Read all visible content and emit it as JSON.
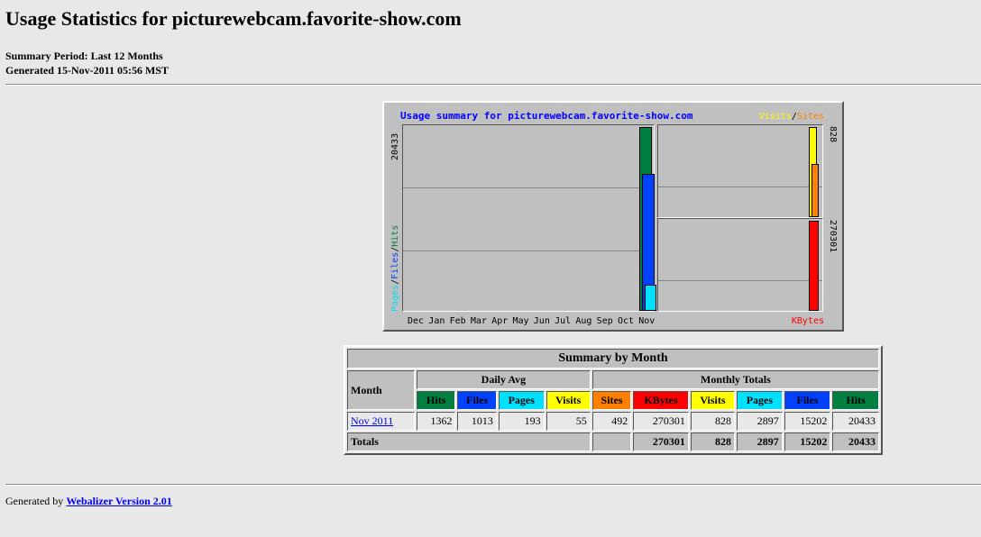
{
  "page": {
    "title": "Usage Statistics for picturewebcam.favorite-show.com",
    "summary_period": "Summary Period: Last 12 Months",
    "generated": "Generated 15-Nov-2011 05:56 MST"
  },
  "colors": {
    "hits": "#008040",
    "files": "#0040ff",
    "pages": "#00e0ff",
    "visits": "#ffff00",
    "sites": "#ff8000",
    "kbytes": "#ff0000"
  },
  "chart": {
    "title": "Usage summary for picturewebcam.favorite-show.com",
    "legend_visits": "Visits",
    "legend_sep": "/",
    "legend_sites": "Sites",
    "legend_kbytes": "KBytes",
    "axis_pages": "Pages",
    "axis_files": "Files",
    "axis_hits": "Hits",
    "max_hits_label": "20433",
    "max_visits_label": "828",
    "max_kbytes_label": "270301",
    "months": [
      "Dec",
      "Jan",
      "Feb",
      "Mar",
      "Apr",
      "May",
      "Jun",
      "Jul",
      "Aug",
      "Sep",
      "Oct",
      "Nov"
    ]
  },
  "chart_data": {
    "type": "bar",
    "categories": [
      "Dec",
      "Jan",
      "Feb",
      "Mar",
      "Apr",
      "May",
      "Jun",
      "Jul",
      "Aug",
      "Sep",
      "Oct",
      "Nov"
    ],
    "series": [
      {
        "name": "Hits",
        "values": [
          0,
          0,
          0,
          0,
          0,
          0,
          0,
          0,
          0,
          0,
          0,
          20433
        ]
      },
      {
        "name": "Files",
        "values": [
          0,
          0,
          0,
          0,
          0,
          0,
          0,
          0,
          0,
          0,
          0,
          15202
        ]
      },
      {
        "name": "Pages",
        "values": [
          0,
          0,
          0,
          0,
          0,
          0,
          0,
          0,
          0,
          0,
          0,
          2897
        ]
      },
      {
        "name": "Visits",
        "values": [
          0,
          0,
          0,
          0,
          0,
          0,
          0,
          0,
          0,
          0,
          0,
          828
        ]
      },
      {
        "name": "Sites",
        "values": [
          0,
          0,
          0,
          0,
          0,
          0,
          0,
          0,
          0,
          0,
          0,
          492
        ]
      },
      {
        "name": "KBytes",
        "values": [
          0,
          0,
          0,
          0,
          0,
          0,
          0,
          0,
          0,
          0,
          0,
          270301
        ]
      }
    ],
    "title": "Usage summary for picturewebcam.favorite-show.com"
  },
  "table": {
    "caption": "Summary by Month",
    "month_header": "Month",
    "daily_avg_header": "Daily Avg",
    "monthly_totals_header": "Monthly Totals",
    "daily_cols": [
      "Hits",
      "Files",
      "Pages",
      "Visits"
    ],
    "monthly_cols": [
      "Sites",
      "KBytes",
      "Visits",
      "Pages",
      "Files",
      "Hits"
    ],
    "row": {
      "month": "Nov 2011",
      "avg_hits": "1362",
      "avg_files": "1013",
      "avg_pages": "193",
      "avg_visits": "55",
      "sites": "492",
      "kbytes": "270301",
      "visits": "828",
      "pages": "2897",
      "files": "15202",
      "hits": "20433"
    },
    "totals": {
      "label": "Totals",
      "kbytes": "270301",
      "visits": "828",
      "pages": "2897",
      "files": "15202",
      "hits": "20433"
    }
  },
  "footer": {
    "prefix": "Generated by",
    "link": "Webalizer Version 2.01"
  }
}
